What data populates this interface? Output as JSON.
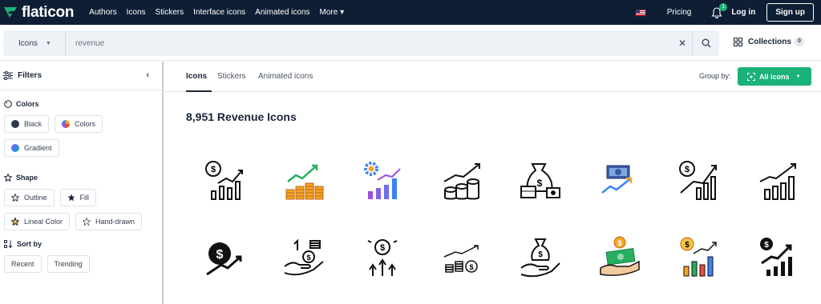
{
  "brand": {
    "name": "flaticon"
  },
  "nav": {
    "links": [
      "Authors",
      "Icons",
      "Stickers",
      "Interface icons",
      "Animated icons",
      "More"
    ],
    "pricing": "Pricing",
    "notifications": "1",
    "login": "Log in",
    "signup": "Sign up"
  },
  "search": {
    "type": "Icons",
    "query": "revenue"
  },
  "collections": {
    "label": "Collections",
    "count": "0"
  },
  "sidebar": {
    "title": "Filters",
    "colors": {
      "title": "Colors",
      "options": [
        "Black",
        "Colors",
        "Gradient"
      ]
    },
    "shape": {
      "title": "Shape",
      "options": [
        "Outline",
        "Fill",
        "Lineal Color",
        "Hand-drawn"
      ]
    },
    "sort": {
      "title": "Sort by",
      "options": [
        "Recent",
        "Trending"
      ]
    }
  },
  "tabs": [
    "Icons",
    "Stickers",
    "Animated icons"
  ],
  "groupby": {
    "label": "Group by:",
    "value": "All icons"
  },
  "results": "8,951 Revenue Icons",
  "icons": [
    "dollar-chart-icon",
    "coin-stacks-growth-icon",
    "gear-bar-chart-icon",
    "coins-arrow-icon",
    "money-bag-cash-icon",
    "banknote-trend-icon",
    "dollar-bar-growth-icon",
    "bar-chart-arrow-icon",
    "dollar-arrow-icon",
    "hand-coins-icon",
    "dollar-bars-icon",
    "coins-chart-icon",
    "hand-money-bag-icon",
    "hand-cash-icon",
    "color-bar-chart-icon",
    "dollar-stair-icon"
  ],
  "colors": {
    "navy": "#0e1f35",
    "green": "#1bb279",
    "orange": "#f5a623",
    "purple": "#9b51e0"
  }
}
